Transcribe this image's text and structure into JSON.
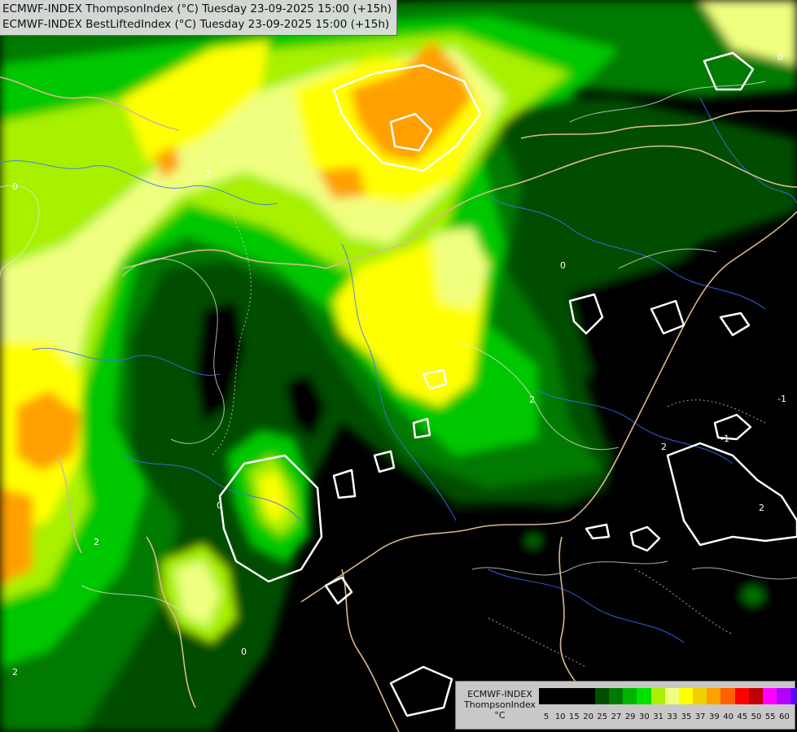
{
  "title": {
    "line1": "ECMWF-INDEX ThompsonIndex (°C) Tuesday 23-09-2025 15:00 (+15h)",
    "line2": "ECMWF-INDEX BestLiftedIndex (°C) Tuesday 23-09-2025 15:00 (+15h)"
  },
  "legend": {
    "model": "ECMWF-INDEX",
    "parameter": "ThompsonIndex",
    "unit": "°C",
    "ticks": [
      "5",
      "10",
      "15",
      "20",
      "25",
      "27",
      "29",
      "30",
      "31",
      "33",
      "35",
      "37",
      "39",
      "40",
      "45",
      "50",
      "55",
      "60"
    ],
    "colors": [
      "#000000",
      "#000000",
      "#000000",
      "#000000",
      "#004d00",
      "#007a00",
      "#00b400",
      "#00e100",
      "#a8f000",
      "#f0ff80",
      "#ffff00",
      "#f0d000",
      "#ffa000",
      "#ff6000",
      "#ff0000",
      "#c00000",
      "#ff00ff",
      "#b400ff",
      "#6000ff",
      "#0000ff"
    ]
  },
  "contour_labels": [
    "0",
    "2",
    "0",
    "2",
    "0",
    "2",
    "-1",
    "2",
    "-1",
    "0",
    "2",
    "0",
    "2"
  ]
}
